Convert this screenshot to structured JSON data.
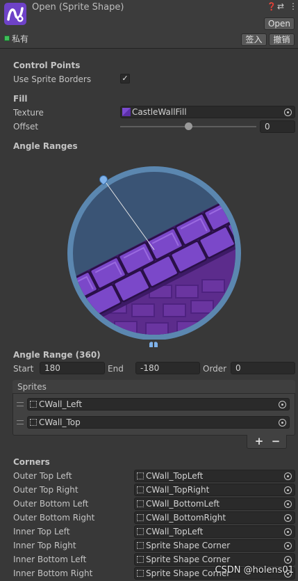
{
  "header": {
    "title": "Open (Sprite Shape)",
    "open_button": "Open",
    "private_label": "私有",
    "checkin_button": "签入",
    "revert_button": "撤销"
  },
  "control_points": {
    "heading": "Control Points",
    "use_sprite_borders_label": "Use Sprite Borders",
    "use_sprite_borders_checked": "✓"
  },
  "fill": {
    "heading": "Fill",
    "texture_label": "Texture",
    "texture_value": "CastleWallFill",
    "offset_label": "Offset",
    "offset_value": "0",
    "offset_slider_fraction": 0.5
  },
  "angle_ranges": {
    "heading": "Angle Ranges"
  },
  "angle_range": {
    "heading": "Angle Range (360)",
    "start_label": "Start",
    "start_value": "180",
    "end_label": "End",
    "end_value": "-180",
    "order_label": "Order",
    "order_value": "0"
  },
  "sprites": {
    "header": "Sprites",
    "items": [
      "CWall_Left",
      "CWall_Top"
    ],
    "add": "+",
    "remove": "−"
  },
  "corners": {
    "heading": "Corners",
    "rows": [
      {
        "label": "Outer Top Left",
        "value": "CWall_TopLeft"
      },
      {
        "label": "Outer Top Right",
        "value": "CWall_TopRight"
      },
      {
        "label": "Outer Bottom Left",
        "value": "CWall_BottomLeft"
      },
      {
        "label": "Outer Bottom Right",
        "value": "CWall_BottomRight"
      },
      {
        "label": "Inner Top Left",
        "value": "CWall_TopLeft"
      },
      {
        "label": "Inner Top Right",
        "value": "Sprite Shape Corner"
      },
      {
        "label": "Inner Bottom Left",
        "value": "Sprite Shape Corner"
      },
      {
        "label": "Inner Bottom Right",
        "value": "Sprite Shape Corner"
      }
    ]
  },
  "watermark": "CSDN @holens01",
  "colors": {
    "background": "#383838",
    "asset_icon": "#6e42c8",
    "preview_ring": "#5b87b0",
    "preview_sky": "#3a5475",
    "brick_purple": "#7b48c9"
  }
}
